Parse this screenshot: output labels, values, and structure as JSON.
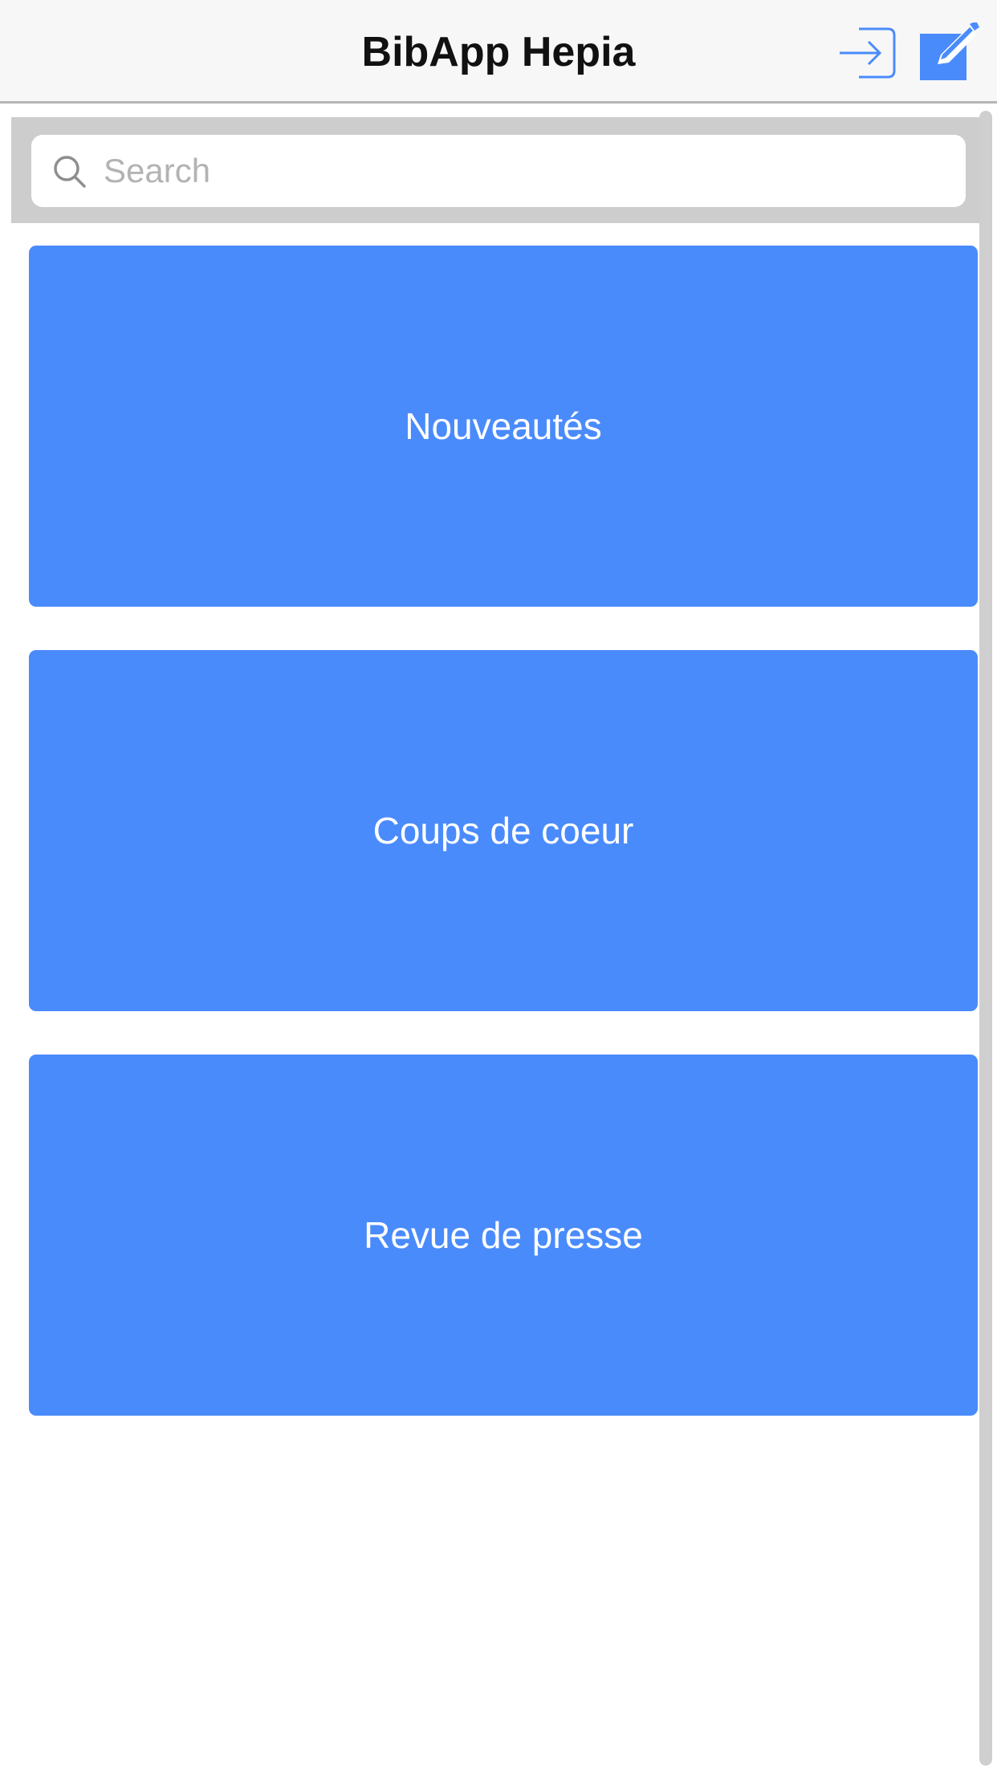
{
  "header": {
    "title": "BibApp Hepia",
    "icons": [
      "login-icon",
      "compose-icon"
    ]
  },
  "search": {
    "placeholder": "Search",
    "value": "",
    "icon": "search-icon"
  },
  "tiles": [
    {
      "label": "Nouveautés"
    },
    {
      "label": "Coups de coeur"
    },
    {
      "label": "Revue de presse"
    }
  ],
  "colors": {
    "accent": "#4a8bfc",
    "navbar_bg": "#f7f7f7",
    "search_bar_bg": "#cdcdcd"
  }
}
